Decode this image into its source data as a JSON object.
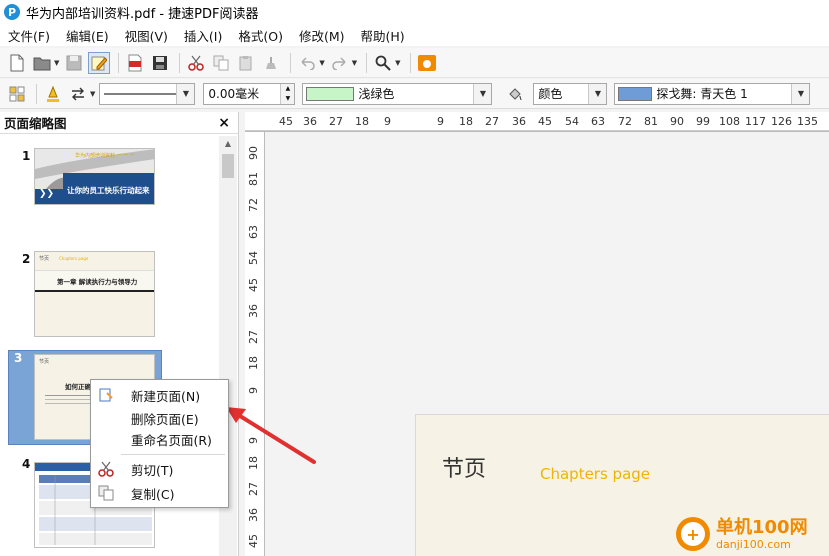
{
  "window": {
    "title": "华为内部培训资料.pdf - 捷速PDF阅读器",
    "app_icon_letter": "P"
  },
  "menu": [
    "文件(F)",
    "编辑(E)",
    "视图(V)",
    "插入(I)",
    "格式(O)",
    "修改(M)",
    "帮助(H)"
  ],
  "toolbar": {
    "icons": [
      "new-page-icon",
      "open-folder-icon",
      "save-icon",
      "edit-icon",
      "pdf-export-icon",
      "save-disk-icon",
      "cut-icon",
      "copy-icon",
      "paste-icon",
      "format-paint-icon",
      "undo-icon",
      "redo-icon",
      "zoom-icon",
      "launch-icon"
    ]
  },
  "format_bar": {
    "line_style": "",
    "line_width": "0.00毫米",
    "fill_color_name": "浅绿色",
    "fill_color_hex": "#c8f5c8",
    "color_mode": "颜色",
    "theme_color_name": "探戈舞: 青天色 1",
    "theme_color_hex": "#6f9bd6"
  },
  "panel": {
    "title": "页面缩略图",
    "close": "×",
    "thumbnails": [
      {
        "number": "1",
        "banner": "华为内部培训资料 一 一 一",
        "text": "让你的员工快乐行动起来"
      },
      {
        "number": "2",
        "header": "节页",
        "sub": "Chapters page",
        "text": "第一章  解读执行力与领导力"
      },
      {
        "number": "3",
        "header": "节页",
        "text": "如何正确"
      },
      {
        "number": "4",
        "text": ""
      }
    ]
  },
  "ruler": {
    "top": [
      "45",
      "36",
      "27",
      "18",
      "9",
      "9",
      "18",
      "27",
      "36",
      "45",
      "54",
      "63",
      "72",
      "81",
      "90",
      "99",
      "108",
      "117",
      "126",
      "135"
    ],
    "left_upper": [
      "90",
      "81",
      "72",
      "63",
      "54",
      "45",
      "36",
      "27",
      "18",
      "9"
    ],
    "left_lower": [
      "9",
      "18",
      "27",
      "36",
      "45"
    ]
  },
  "page": {
    "title": "节页",
    "subtitle": "Chapters page"
  },
  "context_menu": {
    "items": [
      {
        "label": "新建页面(N)",
        "icon": "new-page-icon"
      },
      {
        "label": "删除页面(E)",
        "icon": ""
      },
      {
        "label": "重命名页面(R)",
        "icon": ""
      },
      {
        "label": "剪切(T)",
        "icon": "cut-icon"
      },
      {
        "label": "复制(C)",
        "icon": "copy-icon"
      }
    ]
  },
  "watermark": {
    "name": "单机100网",
    "url": "danji100.com"
  },
  "colors": {
    "arrow": "#e03030",
    "accent_orange": "#f08a00"
  }
}
